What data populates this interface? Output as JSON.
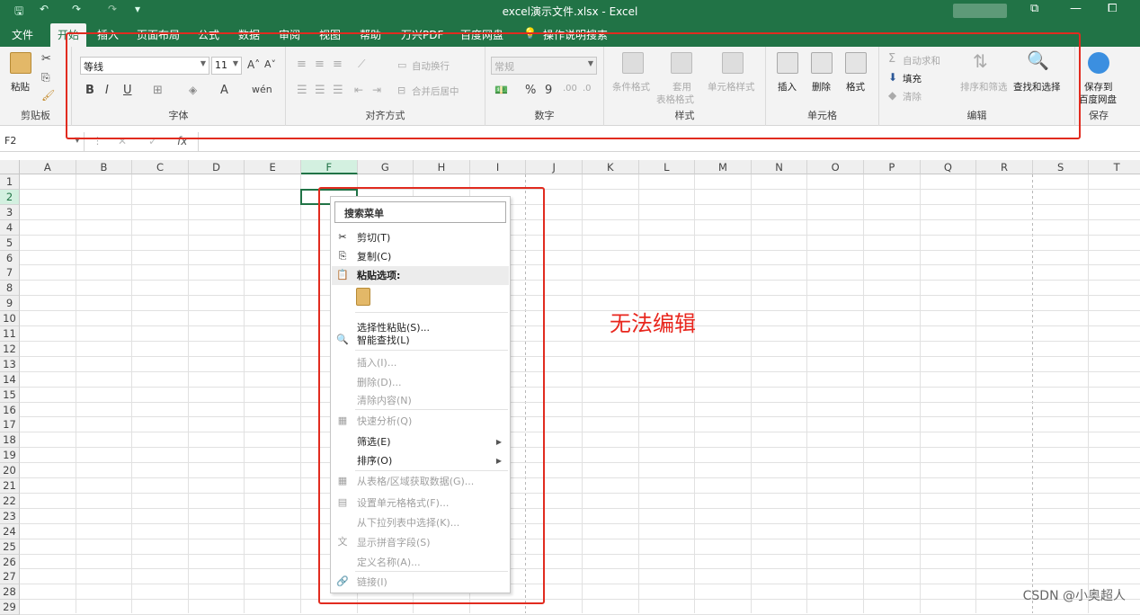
{
  "window": {
    "title": "excel演示文件.xlsx  -  Excel",
    "controls": {
      "restore": "⧉",
      "minimize": "—",
      "maximize": "⧠"
    }
  },
  "quick_access": {
    "save": "🖫",
    "undo": "↶",
    "redo": "↷",
    "customize": "▾"
  },
  "tabs": [
    {
      "label": "文件"
    },
    {
      "label": "开始"
    },
    {
      "label": "插入"
    },
    {
      "label": "页面布局"
    },
    {
      "label": "公式"
    },
    {
      "label": "数据"
    },
    {
      "label": "审阅"
    },
    {
      "label": "视图"
    },
    {
      "label": "帮助"
    },
    {
      "label": "万兴PDF"
    },
    {
      "label": "百度网盘"
    },
    {
      "label": "操作说明搜索"
    }
  ],
  "ribbon": {
    "clipboard": {
      "label": "剪贴板",
      "paste": "粘贴"
    },
    "font": {
      "label": "字体",
      "font_name": "等线",
      "font_size": "11",
      "bold": "B",
      "italic": "I",
      "underline": "U",
      "grow": "A˄",
      "shrink": "A˅",
      "font_color": "A",
      "phonetic": "wén"
    },
    "alignment": {
      "label": "对齐方式",
      "wrap": "自动换行",
      "merge": "合并后居中"
    },
    "number": {
      "label": "数字",
      "format": "常规",
      "percent": "%",
      "comma": "9"
    },
    "styles": {
      "label": "样式",
      "conditional": "条件格式",
      "table_l1": "套用",
      "table_l2": "表格格式",
      "cell_styles": "单元格样式"
    },
    "cells": {
      "label": "单元格",
      "insert": "插入",
      "delete": "删除",
      "format": "格式"
    },
    "editing": {
      "label": "编辑",
      "autosum": "自动求和",
      "fill": "填充",
      "clear": "清除",
      "sort": "排序和筛选",
      "find": "查找和选择"
    },
    "save": {
      "label": "保存",
      "save_l1": "保存到",
      "save_l2": "百度网盘"
    }
  },
  "formula_bar": {
    "name_box": "F2",
    "fx": "fx",
    "cancel": "✕",
    "enter": "✓"
  },
  "columns": [
    "A",
    "B",
    "C",
    "D",
    "E",
    "F",
    "G",
    "H",
    "I",
    "J",
    "K",
    "L",
    "M",
    "N",
    "O",
    "P",
    "Q",
    "R",
    "S",
    "T"
  ],
  "rows": [
    "1",
    "2",
    "3",
    "4",
    "5",
    "6",
    "7",
    "8",
    "9",
    "10",
    "11",
    "12",
    "13",
    "14",
    "15",
    "16",
    "17",
    "18",
    "19",
    "20",
    "21",
    "22",
    "23",
    "24",
    "25",
    "26",
    "27",
    "28",
    "29"
  ],
  "selected": {
    "column": "F",
    "row": "2"
  },
  "context_menu": {
    "search": "搜索菜单",
    "items": [
      {
        "label": "剪切(T)",
        "icon": "✂",
        "disabled": false
      },
      {
        "label": "复制(C)",
        "icon": "⎘",
        "disabled": false
      },
      {
        "label": "粘贴选项:",
        "icon": "📋",
        "disabled": false,
        "header": true
      },
      {
        "label": "选择性粘贴(S)...",
        "icon": "",
        "disabled": false
      },
      {
        "label": "智能查找(L)",
        "icon": "🔍",
        "disabled": false
      },
      {
        "label": "插入(I)...",
        "icon": "",
        "disabled": true
      },
      {
        "label": "删除(D)...",
        "icon": "",
        "disabled": true
      },
      {
        "label": "清除内容(N)",
        "icon": "",
        "disabled": true
      },
      {
        "label": "快速分析(Q)",
        "icon": "▦",
        "disabled": true
      },
      {
        "label": "筛选(E)",
        "icon": "",
        "disabled": false,
        "submenu": "▶"
      },
      {
        "label": "排序(O)",
        "icon": "",
        "disabled": false,
        "submenu": "▶"
      },
      {
        "label": "从表格/区域获取数据(G)...",
        "icon": "▦",
        "disabled": true
      },
      {
        "label": "设置单元格格式(F)...",
        "icon": "▤",
        "disabled": true
      },
      {
        "label": "从下拉列表中选择(K)...",
        "icon": "",
        "disabled": true
      },
      {
        "label": "显示拼音字段(S)",
        "icon": "文",
        "disabled": true
      },
      {
        "label": "定义名称(A)...",
        "icon": "",
        "disabled": true
      },
      {
        "label": "链接(I)",
        "icon": "🔗",
        "disabled": true
      }
    ]
  },
  "annotation": "无法编辑",
  "watermark": "CSDN @小奥超人"
}
